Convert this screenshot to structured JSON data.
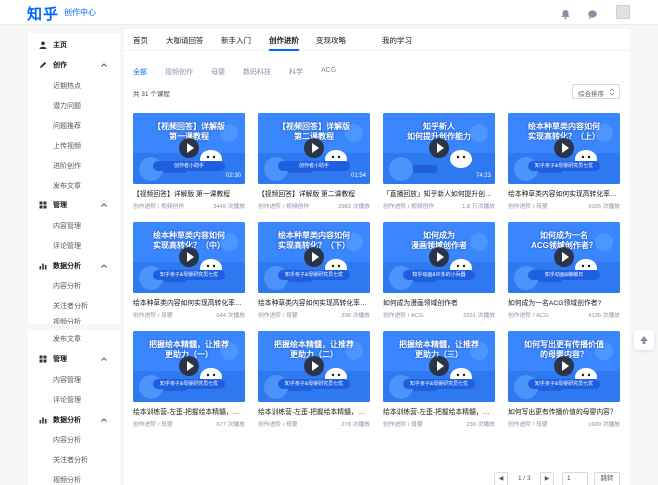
{
  "header": {
    "logo": "知乎",
    "subtitle": "创作中心",
    "icons": [
      "bell-icon",
      "message-icon"
    ],
    "accent": "#0066ff"
  },
  "sidebar": {
    "items": [
      {
        "label": "主页",
        "level": "top",
        "icon": "user-icon"
      },
      {
        "label": "创作",
        "level": "top",
        "icon": "pen-icon",
        "expanded": true
      },
      {
        "label": "近期热点",
        "level": "sub"
      },
      {
        "label": "潜力问题",
        "level": "sub"
      },
      {
        "label": "问题推荐",
        "level": "sub"
      },
      {
        "label": "上传视频",
        "level": "sub"
      },
      {
        "label": "进阶创作",
        "level": "sub"
      },
      {
        "label": "发布文章",
        "level": "sub"
      },
      {
        "label": "管理",
        "level": "top",
        "icon": "grid-icon",
        "expanded": true
      },
      {
        "label": "内容管理",
        "level": "sub"
      },
      {
        "label": "评论管理",
        "level": "sub"
      },
      {
        "label": "数据分析",
        "level": "top",
        "icon": "chart-icon",
        "expanded": true
      },
      {
        "label": "内容分析",
        "level": "sub"
      },
      {
        "label": "关注者分析",
        "level": "sub"
      },
      {
        "label": "视频分析",
        "level": "sub"
      }
    ],
    "items_lower": [
      {
        "label": "发布文章",
        "level": "sub"
      },
      {
        "label": "管理",
        "level": "top",
        "icon": "grid-icon",
        "expanded": true
      },
      {
        "label": "内容管理",
        "level": "sub"
      },
      {
        "label": "评论管理",
        "level": "sub"
      },
      {
        "label": "数据分析",
        "level": "top",
        "icon": "chart-icon",
        "expanded": true
      },
      {
        "label": "内容分析",
        "level": "sub"
      },
      {
        "label": "关注者分析",
        "level": "sub"
      },
      {
        "label": "视频分析",
        "level": "sub"
      }
    ]
  },
  "tabs": [
    {
      "label": "首页",
      "active": false
    },
    {
      "label": "大咖请回答",
      "active": false
    },
    {
      "label": "新手入门",
      "active": false
    },
    {
      "label": "创作进阶",
      "active": true
    },
    {
      "label": "变现攻略",
      "active": false
    },
    {
      "label": "我的学习",
      "active": false
    }
  ],
  "filters": [
    {
      "label": "全部",
      "active": true
    },
    {
      "label": "视频创作",
      "active": false
    },
    {
      "label": "母婴",
      "active": false
    },
    {
      "label": "数码科技",
      "active": false
    },
    {
      "label": "科学",
      "active": false
    },
    {
      "label": "ACG",
      "active": false
    }
  ],
  "course_count": "共 31 个课程",
  "sort": {
    "label": "综合排序"
  },
  "cards": [
    {
      "thumb_title": "【视频回答】详解版\n第一课教程",
      "badge": "创作者小助手",
      "duration": "02:30",
      "title": "【视频回答】详解版 第一课教程",
      "category": "创作进阶 / 视频创作",
      "plays": "3449 次播放"
    },
    {
      "thumb_title": "【视频回答】详解版\n第二课教程",
      "badge": "创作者小助手",
      "duration": "01:54",
      "title": "【视频回答】详解版 第二课教程",
      "category": "创作进阶 / 视频创作",
      "plays": "2983 次播放"
    },
    {
      "thumb_title": "知乎新人\n如何提升创作能力",
      "badge": "",
      "duration": "74:23",
      "title": "「直播回放」知乎新人如何提升创作能力",
      "category": "创作进阶 / 视频创作",
      "plays": "1.8 万次播放"
    },
    {
      "thumb_title": "绘本种草类内容如何\n实现高转化？（上）",
      "badge": "知乎亲子&母婴研究员七优",
      "duration": "",
      "title": "绘本种草类内容如何实现高转化率？（上）",
      "category": "创作进阶 / 母婴",
      "plays": "1005 次播放"
    },
    {
      "thumb_title": "绘本种草类内容如何\n实现高转化？（中）",
      "badge": "知乎亲子&母婴研究员七优",
      "duration": "",
      "title": "绘本种草类内容如何实现高转化率？（中）",
      "category": "创作进阶 / 母婴",
      "plays": "644 次播放"
    },
    {
      "thumb_title": "绘本种草类内容如何\n实现高转化？（下）",
      "badge": "知乎亲子&母婴研究员七优",
      "duration": "",
      "title": "绘本种草类内容如何实现高转化率？（下）",
      "category": "创作进阶 / 母婴",
      "plays": "298 次播放"
    },
    {
      "thumb_title": "如何成为\n漫画领域创作者",
      "badge": "知乎动画&许多的小兵器",
      "duration": "",
      "title": "如何成为漫画领域创作者",
      "category": "创作进阶 / ACG",
      "plays": "3231 次播放"
    },
    {
      "thumb_title": "如何成为一名\nACG领域创作者？",
      "badge": "知乎动画&萌萌日",
      "duration": "",
      "title": "如何成为一名ACG领域创作者?",
      "category": "创作进阶 / ACG",
      "plays": "4136 次播放"
    },
    {
      "thumb_title": "把握绘本精髓，让推荐\n更助力（一）",
      "badge": "知乎亲子&母婴研究员七优",
      "duration": "",
      "title": "绘本训练营-左歪-把握绘本精髓，让推荐更助力（一）",
      "category": "创作进阶 / 母婴",
      "plays": "677 次播放"
    },
    {
      "thumb_title": "把握绘本精髓，让推荐\n更助力（二）",
      "badge": "知乎亲子&母婴研究员七优",
      "duration": "",
      "title": "绘本训练营-左歪-把握绘本精髓，让推荐更助力（二）",
      "category": "创作进阶 / 母婴",
      "plays": "278 次播放"
    },
    {
      "thumb_title": "把握绘本精髓，让推荐\n更助力（三）",
      "badge": "知乎亲子&母婴研究员七优",
      "duration": "",
      "title": "绘本训练营-左歪-把握绘本精髓，让推荐更助力（三）",
      "category": "创作进阶 / 母婴",
      "plays": "239 次播放"
    },
    {
      "thumb_title": "如何写出更有传播价值\n的母婴内容？",
      "badge": "知乎亲子&母婴研究员七优",
      "duration": "",
      "title": "如何写出更有传播价值的母婴内容？",
      "category": "创作进阶 / 母婴",
      "plays": "1600 次播放"
    }
  ],
  "pagination": {
    "prev": "◀",
    "info": "1 / 3",
    "next": "▶",
    "input_value": "1",
    "jump_label": "跳转"
  }
}
